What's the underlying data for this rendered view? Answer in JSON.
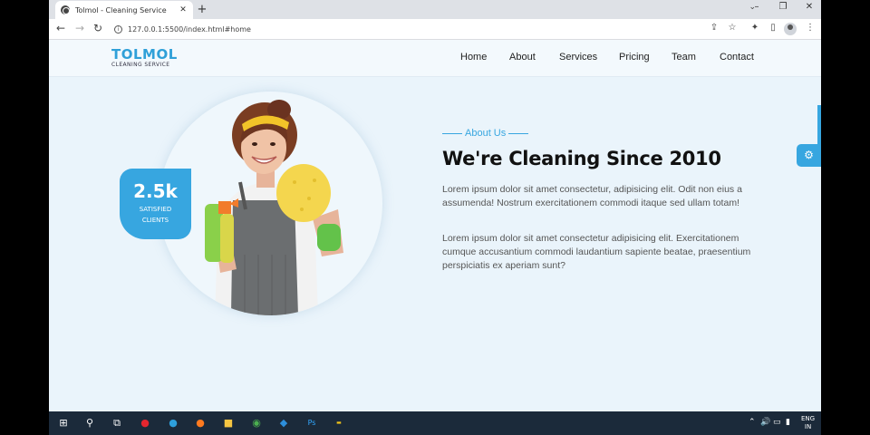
{
  "browser": {
    "tab_title": "Tolmol - Cleaning Service",
    "tab_close": "✕",
    "new_tab": "+",
    "url": "127.0.0.1:5500/index.html#home"
  },
  "site": {
    "logo_name": "TOLMOL",
    "logo_sub": "CLEANING SERVICE",
    "nav": [
      "Home",
      "About",
      "Services",
      "Pricing",
      "Team",
      "Contact"
    ]
  },
  "about": {
    "badge_number": "2.5k",
    "badge_label_1": "SATISFIED",
    "badge_label_2": "CLIENTS",
    "eyebrow": "About Us",
    "heading": "We're Cleaning Since 2010",
    "para1": "Lorem ipsum dolor sit amet consectetur, adipisicing elit. Odit non eius a assumenda! Nostrum exercitationem commodi itaque sed ullam totam!",
    "para2": "Lorem ipsum dolor sit amet consectetur adipisicing elit. Exercitationem cumque accusantium commodi laudantium sapiente beatae, praesentium perspiciatis ex aperiam sunt?"
  },
  "taskbar": {
    "lang_1": "ENG",
    "lang_2": "IN"
  },
  "colors": {
    "accent": "#37a6e0",
    "page_bg": "#eaf4fb",
    "taskbar": "#1b2a3a"
  }
}
